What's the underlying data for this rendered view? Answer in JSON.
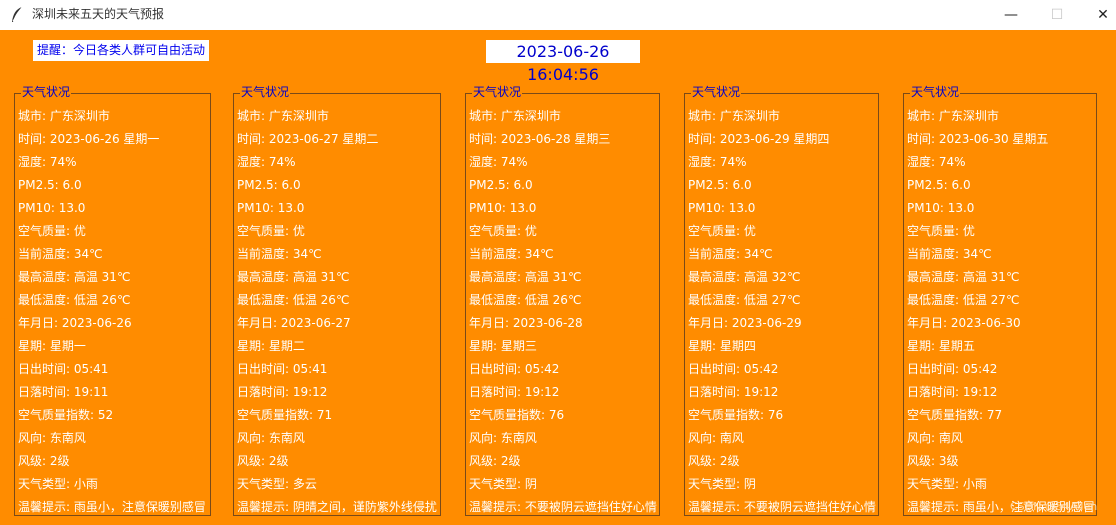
{
  "window": {
    "title": "深圳未来五天的天气预报",
    "min": "—",
    "max": "☐",
    "close": "✕"
  },
  "tip": "提醒：今日各类人群可自由活动",
  "clock": "2023-06-26 16:04:56",
  "panels": [
    {
      "title": "天气状况",
      "rows": [
        "城市: 广东深圳市",
        "时间: 2023-06-26 星期一",
        "湿度: 74%",
        "PM2.5: 6.0",
        "PM10: 13.0",
        "空气质量: 优",
        "当前温度: 34℃",
        "最高温度: 高温 31℃",
        "最低温度: 低温 26℃",
        "年月日: 2023-06-26",
        "星期: 星期一",
        "日出时间: 05:41",
        "日落时间: 19:11",
        "空气质量指数: 52",
        "风向: 东南风",
        "风级: 2级",
        "天气类型: 小雨",
        "温馨提示: 雨虽小，注意保暖别感冒"
      ]
    },
    {
      "title": "天气状况",
      "rows": [
        "城市: 广东深圳市",
        "时间: 2023-06-27 星期二",
        "湿度: 74%",
        "PM2.5: 6.0",
        "PM10: 13.0",
        "空气质量: 优",
        "当前温度: 34℃",
        "最高温度: 高温 31℃",
        "最低温度: 低温 26℃",
        "年月日: 2023-06-27",
        "星期: 星期二",
        "日出时间: 05:41",
        "日落时间: 19:12",
        "空气质量指数: 71",
        "风向: 东南风",
        "风级: 2级",
        "天气类型: 多云",
        "温馨提示: 阴晴之间，谨防紫外线侵扰"
      ]
    },
    {
      "title": "天气状况",
      "rows": [
        "城市: 广东深圳市",
        "时间: 2023-06-28 星期三",
        "湿度: 74%",
        "PM2.5: 6.0",
        "PM10: 13.0",
        "空气质量: 优",
        "当前温度: 34℃",
        "最高温度: 高温 31℃",
        "最低温度: 低温 26℃",
        "年月日: 2023-06-28",
        "星期: 星期三",
        "日出时间: 05:42",
        "日落时间: 19:12",
        "空气质量指数: 76",
        "风向: 东南风",
        "风级: 2级",
        "天气类型: 阴",
        "温馨提示: 不要被阴云遮挡住好心情"
      ]
    },
    {
      "title": "天气状况",
      "rows": [
        "城市: 广东深圳市",
        "时间: 2023-06-29 星期四",
        "湿度: 74%",
        "PM2.5: 6.0",
        "PM10: 13.0",
        "空气质量: 优",
        "当前温度: 34℃",
        "最高温度: 高温 32℃",
        "最低温度: 低温 27℃",
        "年月日: 2023-06-29",
        "星期: 星期四",
        "日出时间: 05:42",
        "日落时间: 19:12",
        "空气质量指数: 76",
        "风向: 南风",
        "风级: 2级",
        "天气类型: 阴",
        "温馨提示: 不要被阴云遮挡住好心情"
      ]
    },
    {
      "title": "天气状况",
      "rows": [
        "城市: 广东深圳市",
        "时间: 2023-06-30 星期五",
        "湿度: 74%",
        "PM2.5: 6.0",
        "PM10: 13.0",
        "空气质量: 优",
        "当前温度: 34℃",
        "最高温度: 高温 31℃",
        "最低温度: 低温 27℃",
        "年月日: 2023-06-30",
        "星期: 星期五",
        "日出时间: 05:42",
        "日落时间: 19:12",
        "空气质量指数: 77",
        "风向: 南风",
        "风级: 3级",
        "天气类型: 小雨",
        "温馨提示: 雨虽小，注意保暖别感冒"
      ]
    }
  ],
  "watermark": "CSDN @54Allen",
  "colors": {
    "background": "#ff8c00",
    "label_title": "#0000cc",
    "text": "#ffffff"
  }
}
